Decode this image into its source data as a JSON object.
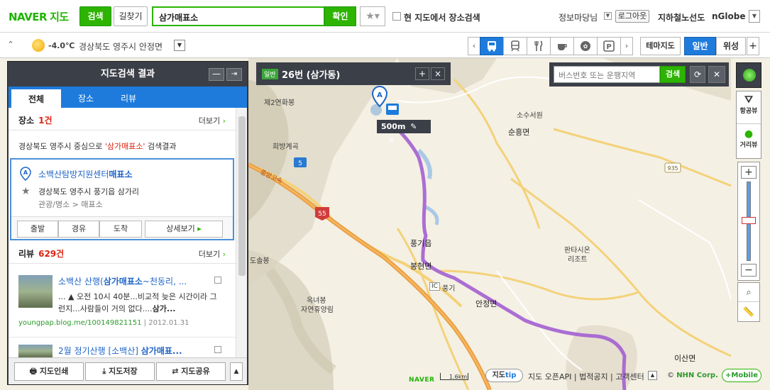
{
  "header": {
    "logo_brand": "NAVER",
    "logo_map": "지도",
    "search_tab": "검색",
    "route_tab": "길찾기",
    "search_value": "삼가매표소",
    "search_button": "확인",
    "favorite_icon": "star-icon",
    "area_search_label": "현 지도에서 장소검색",
    "user_label": "정보마당님",
    "logout": "로그아웃",
    "subway_link": "지하철노선도",
    "nglobe_link": "nGlobe"
  },
  "infobar": {
    "weather_icon": "sun-icon",
    "temperature": "-4.0℃",
    "location": "경상북도 영주시 안정면",
    "categories": [
      "bus-icon",
      "train-icon",
      "restaurant-icon",
      "cafe-icon",
      "gas-station-icon",
      "parking-icon"
    ],
    "theme_map": "테마지도",
    "normal": "일반",
    "satellite": "위성",
    "plus": "+"
  },
  "panel": {
    "title": "지도검색 결과",
    "tabs": [
      "전체",
      "장소",
      "리뷰"
    ],
    "places_label": "장소",
    "places_count": "1건",
    "more": "더보기",
    "result_desc_prefix": "경상북도 영주시 중심으로 ",
    "result_query": "'삼가매표소'",
    "result_desc_suffix": " 검색결과",
    "place": {
      "marker": "A",
      "name_prefix": "소백산탐방지원센터",
      "name_match": "매표소",
      "address": "경상북도 영주시 풍기읍 삼가리",
      "category": "관광/명소 > 매표소",
      "actions": [
        "출발",
        "경유",
        "도착",
        "상세보기"
      ]
    },
    "reviews_label": "리뷰",
    "reviews_count": "629건",
    "reviews": [
      {
        "title_prefix": "소백산 산행(",
        "title_match": "삼가매표소",
        "title_suffix": "~천동리, ...",
        "body_prefix": "... ▲ 오전 10시 40분...비교적 늦은 시간이라 그런지...사람들이 거의 없다....",
        "body_match": "삼가...",
        "source": "youngpap.blog.me/100149821151",
        "date": "2012.01.31"
      },
      {
        "title_prefix": "2월 정기산행 [소백산] ",
        "title_match": "삼가매표...",
        "title_suffix": ""
      }
    ],
    "footer": [
      "지도인쇄",
      "지도저장",
      "지도공유"
    ]
  },
  "bus": {
    "badge": "일반",
    "title": "26번 (삼가동)",
    "plus": "+",
    "close": "×",
    "distance": "500m"
  },
  "route_search": {
    "placeholder": "버스번호 또는 운행지역",
    "button": "검색"
  },
  "controls": {
    "aerial": "항공뷰",
    "street": "거리뷰"
  },
  "map_labels": {
    "je2yeonhwabong": "제2연화봉",
    "sosuseowon": "소수서원",
    "sunheungmyeon": "순흥면",
    "huibanggyegok": "희방계곡",
    "road5": "5",
    "road935": "935",
    "road55": "55",
    "jungang": "중앙고속",
    "punggieup": "풍기읍",
    "bonghyeonmyeon": "봉현면",
    "dosolbong": "도솔봉",
    "ic": "IC",
    "punggi": "풍기",
    "okneobong": "옥녀봉",
    "forest": "자연휴양림",
    "anjeongmyeon": "안정면",
    "pantasion": "판타시온",
    "resort": "리조트",
    "isanmyeon": "이산면"
  },
  "bottom": {
    "naver": "NAVER",
    "scale": "1.6km",
    "tip_label": "지도",
    "tip_word": "tip",
    "links": "지도 오픈API | 법적공지 | 고객센터",
    "copyright_prefix": "© ",
    "copyright_brand": "NHN Corp.",
    "mobile": "+Mobile"
  },
  "colors": {
    "naver_green": "#2cb400",
    "blue_accent": "#1e7bdc",
    "bus_route": "#a35fd0",
    "panel_dark": "#3b3f48"
  }
}
